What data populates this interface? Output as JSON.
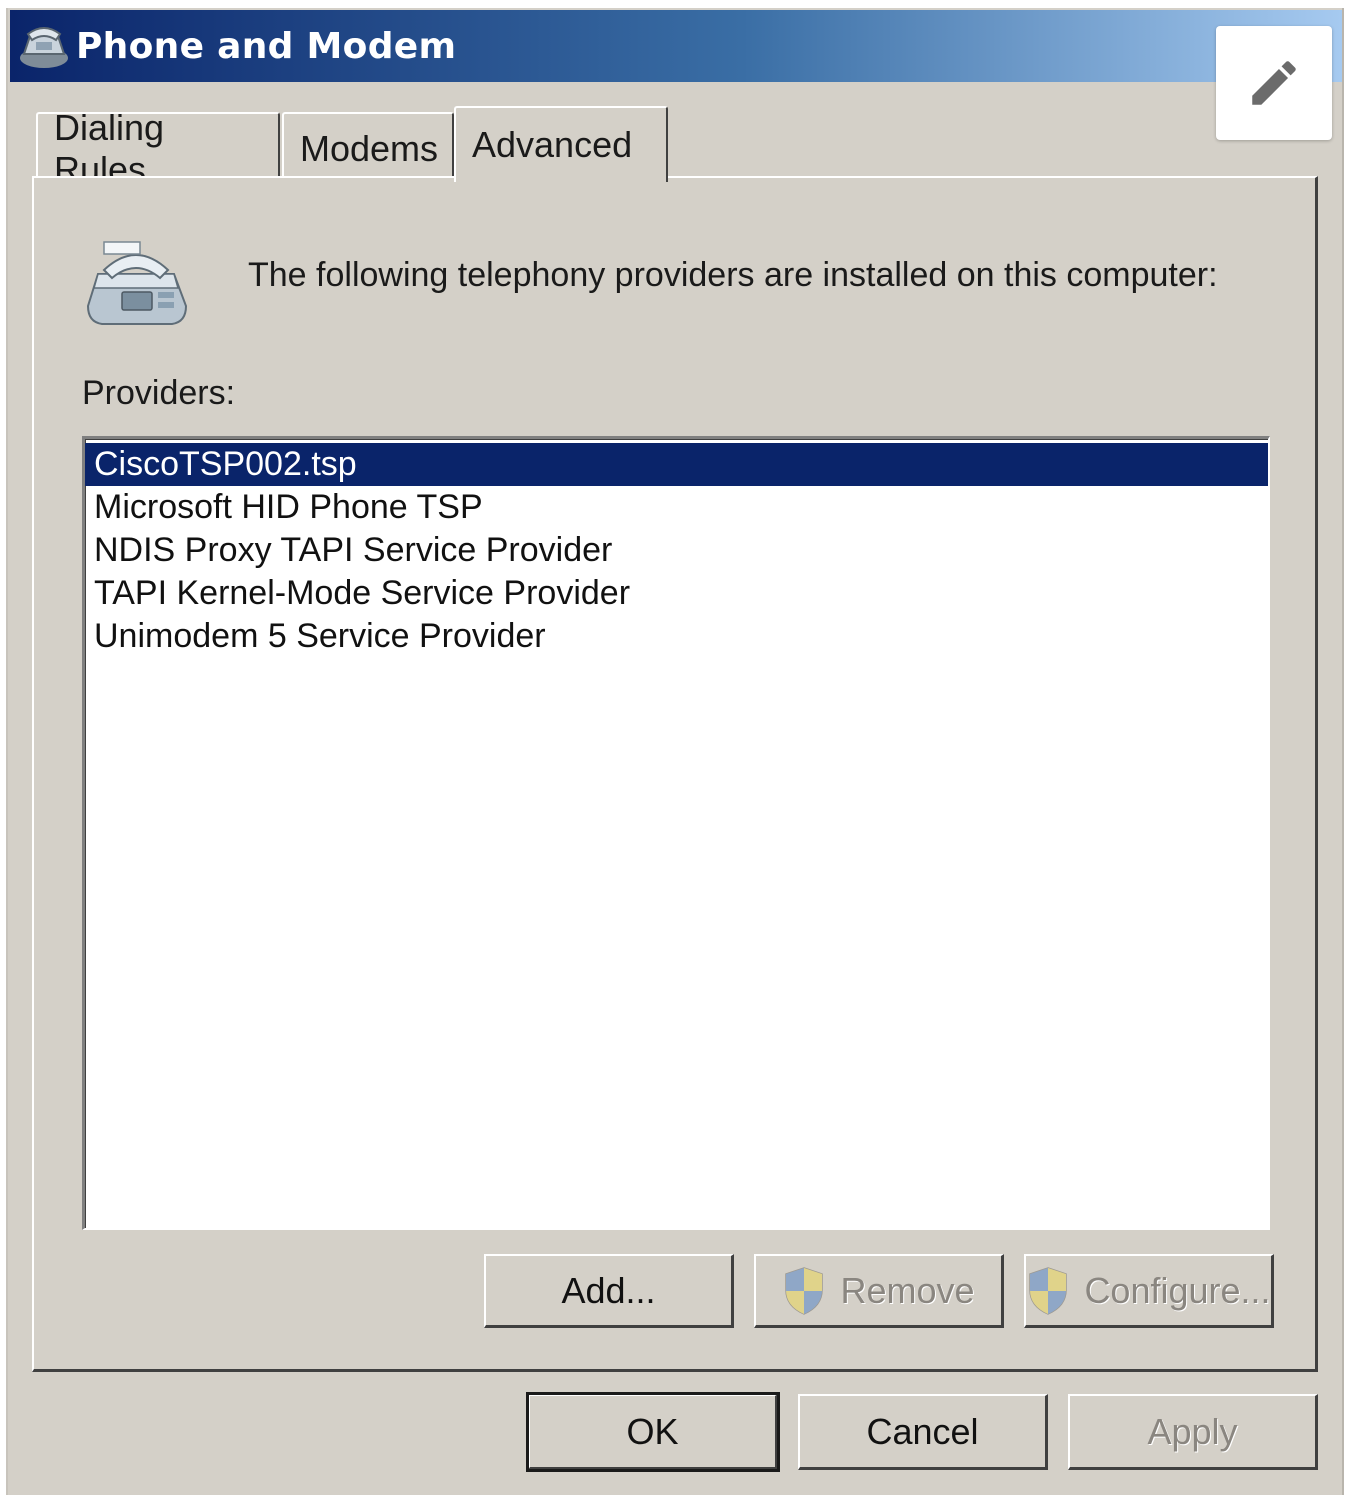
{
  "window": {
    "title": "Phone and Modem"
  },
  "tabs": [
    {
      "label": "Dialing Rules",
      "active": false
    },
    {
      "label": "Modems",
      "active": false
    },
    {
      "label": "Advanced",
      "active": true
    }
  ],
  "advanced": {
    "info_text": "The following telephony providers are installed on this computer:",
    "providers_label": "Providers:",
    "providers": [
      {
        "label": "CiscoTSP002.tsp",
        "selected": true
      },
      {
        "label": "Microsoft HID Phone TSP",
        "selected": false
      },
      {
        "label": "NDIS Proxy TAPI Service Provider",
        "selected": false
      },
      {
        "label": "TAPI Kernel-Mode Service Provider",
        "selected": false
      },
      {
        "label": "Unimodem 5 Service Provider",
        "selected": false
      }
    ],
    "buttons": {
      "add": "Add...",
      "remove": "Remove",
      "configure": "Configure..."
    }
  },
  "footer": {
    "ok": "OK",
    "cancel": "Cancel",
    "apply": "Apply"
  },
  "colors": {
    "dialog_bg": "#d4d0c8",
    "titlebar_start": "#0a246a",
    "titlebar_end": "#a6caf0",
    "selection": "#0a246a"
  },
  "icons": [
    "phone-modem-app-icon",
    "pencil-icon",
    "telephone-fax-icon",
    "uac-shield-icon"
  ]
}
